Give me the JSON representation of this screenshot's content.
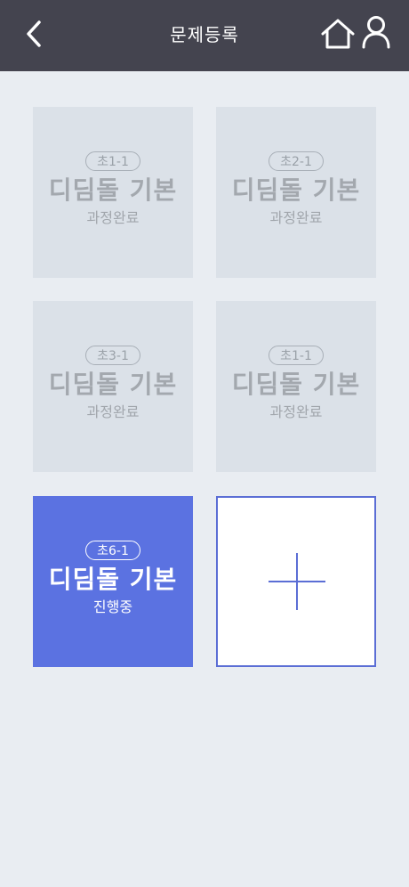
{
  "header": {
    "title": "문제등록",
    "back_icon": "chevron-left-icon",
    "home_icon": "home-icon",
    "user_icon": "user-icon",
    "bg_color": "#44444f"
  },
  "cards": [
    {
      "badge": "초1-1",
      "name": "디딤돌 기본",
      "status": "과정완료",
      "state": "done"
    },
    {
      "badge": "초2-1",
      "name": "디딤돌 기본",
      "status": "과정완료",
      "state": "done"
    },
    {
      "badge": "초3-1",
      "name": "디딤돌 기본",
      "status": "과정완료",
      "state": "done"
    },
    {
      "badge": "초1-1",
      "name": "디딤돌 기본",
      "status": "과정완료",
      "state": "done"
    },
    {
      "badge": "초6-1",
      "name": "디딤돌 기본",
      "status": "진행중",
      "state": "active"
    }
  ],
  "add_card": {
    "icon": "plus-icon"
  },
  "colors": {
    "accent": "#5b72e1",
    "page_bg": "#e9edf2",
    "done_card_bg": "#dbe1e8"
  }
}
